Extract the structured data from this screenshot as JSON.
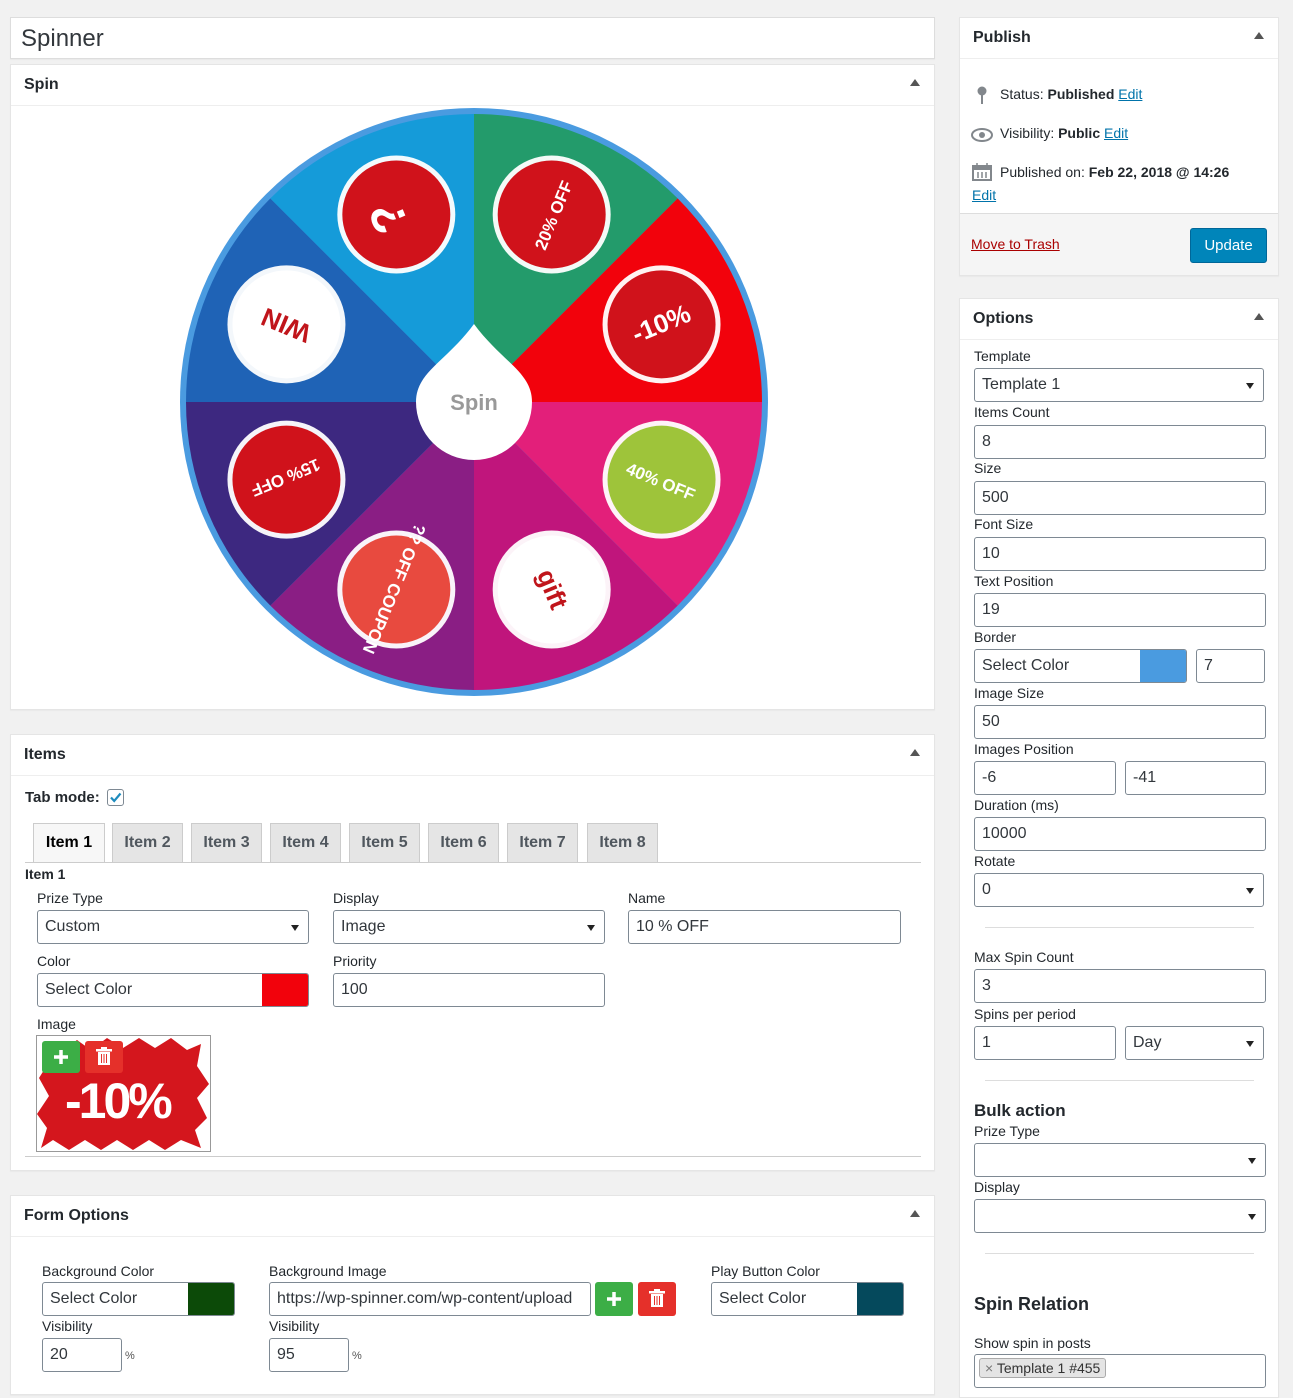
{
  "title": "Spinner",
  "spin_box": {
    "title": "Spin",
    "center_label": "Spin",
    "border_color": "#4a9be0",
    "segments": [
      {
        "color": "#239b6b",
        "badge_text": "20% OFF",
        "badge_color": "#d0121b"
      },
      {
        "color": "#f2020c",
        "badge_text": "-10%",
        "badge_color": "#d0121b"
      },
      {
        "color": "#e31f7a",
        "badge_text": "40% OFF",
        "badge_color": "#9ec43a"
      },
      {
        "color": "#c0157c",
        "badge_text": "gift",
        "badge_color": "#ffffff"
      },
      {
        "color": "#8a1e84",
        "badge_text": "?? OFF COUPON",
        "badge_color": "#e84a3f"
      },
      {
        "color": "#3d2880",
        "badge_text": "15% OFF",
        "badge_color": "#d0121b"
      },
      {
        "color": "#1f63b6",
        "badge_text": "WIN",
        "badge_color": "#ffffff"
      },
      {
        "color": "#159bd9",
        "badge_text": "?",
        "badge_color": "#d0121b"
      }
    ]
  },
  "items_box": {
    "title": "Items",
    "tab_mode_label": "Tab mode:",
    "tabs": [
      "Item 1",
      "Item 2",
      "Item 3",
      "Item 4",
      "Item 5",
      "Item 6",
      "Item 7",
      "Item 8"
    ],
    "section_title": "Item 1",
    "prize_type_label": "Prize Type",
    "prize_type_value": "Custom",
    "display_label": "Display",
    "display_value": "Image",
    "name_label": "Name",
    "name_value": "10 % OFF",
    "color_label": "Color",
    "color_placeholder": "Select Color",
    "color_value": "#f2020c",
    "priority_label": "Priority",
    "priority_value": "100",
    "image_label": "Image",
    "image_text": "-10%"
  },
  "form_options": {
    "title": "Form Options",
    "bg_color_label": "Background Color",
    "bg_color_placeholder": "Select Color",
    "bg_color_value": "#0c4a08",
    "visibility_label": "Visibility",
    "visibility_1": "20",
    "pct": "%",
    "bg_image_label": "Background Image",
    "bg_image_value": "https://wp-spinner.com/wp-content/upload",
    "visibility_2": "95",
    "play_color_label": "Play Button Color",
    "play_color_placeholder": "Select Color",
    "play_color_value": "#05495c"
  },
  "publish": {
    "title": "Publish",
    "status_label": "Status:",
    "status_value": "Published",
    "visibility_label": "Visibility:",
    "visibility_value": "Public",
    "published_label": "Published on:",
    "published_value": "Feb 22, 2018 @ 14:26",
    "edit": "Edit",
    "trash": "Move to Trash",
    "update": "Update"
  },
  "options": {
    "title": "Options",
    "template_label": "Template",
    "template_value": "Template 1",
    "items_count_label": "Items Count",
    "items_count_value": "8",
    "size_label": "Size",
    "size_value": "500",
    "font_size_label": "Font Size",
    "font_size_value": "10",
    "text_position_label": "Text Position",
    "text_position_value": "19",
    "border_label": "Border",
    "border_placeholder": "Select Color",
    "border_color": "#4a9be0",
    "border_width_value": "7",
    "image_size_label": "Image Size",
    "image_size_value": "50",
    "images_position_label": "Images Position",
    "images_position_x": "-6",
    "images_position_y": "-41",
    "duration_label": "Duration (ms)",
    "duration_value": "10000",
    "rotate_label": "Rotate",
    "rotate_value": "0",
    "max_spin_label": "Max Spin Count",
    "max_spin_value": "3",
    "spins_period_label": "Spins per period",
    "spins_period_value": "1",
    "period_value": "Day",
    "bulk_title": "Bulk action",
    "bulk_prize_label": "Prize Type",
    "bulk_display_label": "Display",
    "relation_title": "Spin Relation",
    "show_in_posts_label": "Show spin in posts",
    "relation_tag": "Template 1 #455",
    "tag_remove": "×"
  }
}
